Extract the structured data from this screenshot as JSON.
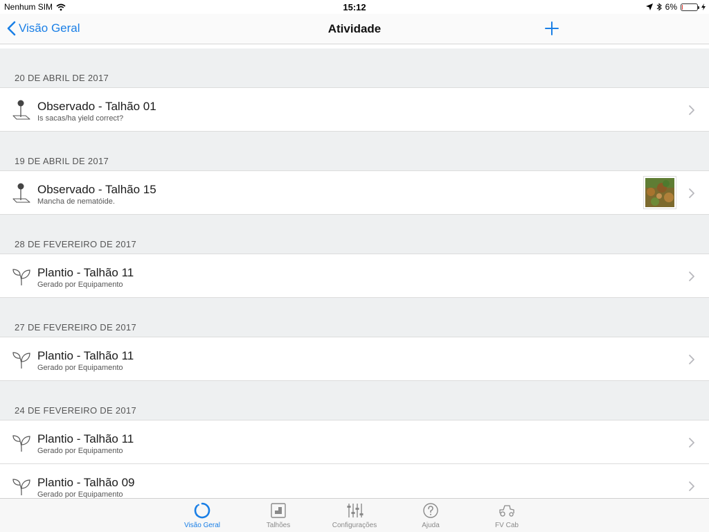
{
  "statusbar": {
    "carrier": "Nenhum SIM",
    "time": "15:12",
    "battery_percent": "6%",
    "battery_level": 0.06
  },
  "navbar": {
    "back_label": "Visão Geral",
    "title": "Atividade"
  },
  "sections": [
    {
      "date": "20 DE ABRIL DE 2017",
      "rows": [
        {
          "type": "observation",
          "title": "Observado - Talhão 01",
          "subtitle": "Is sacas/ha yield correct?",
          "has_thumbnail": false
        }
      ]
    },
    {
      "date": "19 DE ABRIL DE 2017",
      "rows": [
        {
          "type": "observation",
          "title": "Observado - Talhão 15",
          "subtitle": "Mancha de nematóide.",
          "has_thumbnail": true
        }
      ]
    },
    {
      "date": "28 DE FEVEREIRO DE 2017",
      "rows": [
        {
          "type": "planting",
          "title": "Plantio - Talhão 11",
          "subtitle": "Gerado por Equipamento",
          "has_thumbnail": false
        }
      ]
    },
    {
      "date": "27 DE FEVEREIRO DE 2017",
      "rows": [
        {
          "type": "planting",
          "title": "Plantio - Talhão 11",
          "subtitle": "Gerado por Equipamento",
          "has_thumbnail": false
        }
      ]
    },
    {
      "date": "24 DE FEVEREIRO DE 2017",
      "rows": [
        {
          "type": "planting",
          "title": "Plantio - Talhão 11",
          "subtitle": "Gerado por Equipamento",
          "has_thumbnail": false
        },
        {
          "type": "planting",
          "title": "Plantio - Talhão 09",
          "subtitle": "Gerado por Equipamento",
          "has_thumbnail": false
        }
      ]
    }
  ],
  "tabs": [
    {
      "label": "Visão Geral",
      "icon": "overview-icon",
      "active": true
    },
    {
      "label": "Talhões",
      "icon": "fields-icon",
      "active": false
    },
    {
      "label": "Configurações",
      "icon": "settings-sliders-icon",
      "active": false
    },
    {
      "label": "Ajuda",
      "icon": "help-icon",
      "active": false
    },
    {
      "label": "FV Cab",
      "icon": "tractor-icon",
      "active": false
    }
  ],
  "colors": {
    "accent": "#1a7fe6",
    "list_background": "#eef0f1",
    "battery_low": "#e0302a"
  }
}
